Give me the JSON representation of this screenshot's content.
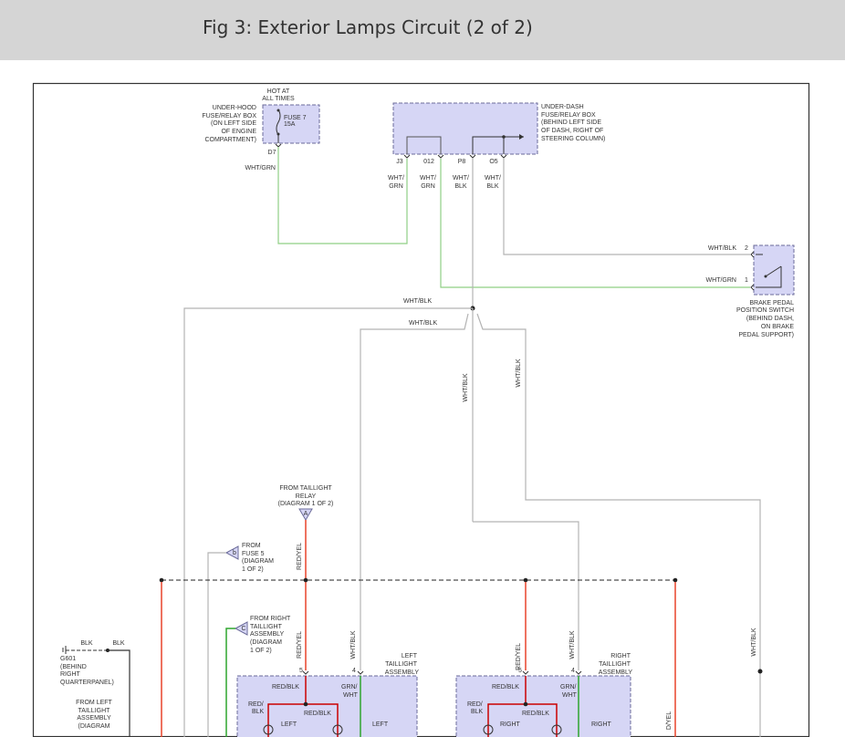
{
  "header": {
    "title": "Fig 3: Exterior Lamps Circuit (2 of 2)"
  },
  "colors": {
    "white_green_wire": "#8fcf85",
    "white_black_wire": "#b3b3b3",
    "red_wire": "#e8432a",
    "green_wire": "#2fa52f",
    "red_black_wire": "#cc0000",
    "component_fill": "#d6d6f5",
    "component_border": "#6b6b9a"
  },
  "labels": {
    "hot_at": "HOT AT",
    "all_times": "ALL TIMES",
    "underhood_1": "UNDER-HOOD",
    "underhood_2": "FUSE/RELAY BOX",
    "underhood_3": "(ON LEFT SIDE",
    "underhood_4": "OF ENGINE",
    "underhood_5": "COMPARTMENT)",
    "fuse7": "FUSE 7",
    "fuse7_amp": "15A",
    "pin_d7": "D7",
    "wire_d7": "WHT/GRN",
    "underdash_1": "UNDER-DASH",
    "underdash_2": "FUSE/RELAY BOX",
    "underdash_3": "(BEHIND LEFT SIDE",
    "underdash_4": "OF DASH, RIGHT OF",
    "underdash_5": "STEERING COLUMN)",
    "pin_j3": "J3",
    "pin_o12": "012",
    "pin_p8": "P8",
    "pin_o5": "O5",
    "wht": "WHT/",
    "grn": "GRN",
    "blk": "BLK",
    "bp_wire2": "WHT/BLK",
    "bp_pin2": "2",
    "bp_wire1": "WHT/GRN",
    "bp_pin1": "1",
    "bp_1": "BRAKE PEDAL",
    "bp_2": "POSITION SWITCH",
    "bp_3": "(BEHIND DASH,",
    "bp_4": "ON BRAKE",
    "bp_5": "PEDAL SUPPORT)",
    "wht_blk_top": "WHT/BLK",
    "wht_blk_mid": "WHT/BLK",
    "wht_blk_v1": "WHT/BLK",
    "wht_blk_v2": "WHT/BLK",
    "relay_1": "FROM TAILLIGHT",
    "relay_2": "RELAY",
    "relay_3": "(DIAGRAM 1 OF 2)",
    "conn_a": "A",
    "conn_b": "b",
    "conn_c": "C",
    "fuse5_1": "FROM",
    "fuse5_2": "FUSE 5",
    "fuse5_3": "(DIAGRAM",
    "fuse5_4": "1 OF 2)",
    "rt_1": "FROM RIGHT",
    "rt_2": "TAILLIGHT",
    "rt_3": "ASSEMBLY",
    "rt_4": "(DIAGRAM",
    "rt_5": "1 OF 2)",
    "red_yel_v1": "RED/YEL",
    "red_yel_v2": "RED/YEL",
    "red_yel_v3": "RED/YEL",
    "wht_blk_v3": "WHT/BLK",
    "wht_blk_v4": "WHT/BLK",
    "wht_blk_v5": "WHT/BLK",
    "dyel_partial": "D/YEL",
    "g601_blk1": "BLK",
    "g601_blk2": "BLK",
    "g601_1": "G601",
    "g601_2": "(BEHIND",
    "g601_3": "RIGHT",
    "g601_4": "QUARTERPANEL)",
    "lt_1": "LEFT",
    "lt_2": "TAILLIGHT",
    "lt_3": "ASSEMBLY",
    "rta_1": "RIGHT",
    "rta_2": "TAILLIGHT",
    "rta_3": "ASSEMBLY",
    "pin5_l": "5",
    "pin4_l": "4",
    "pin5_r": "5",
    "pin4_r": "4",
    "redblk_l1": "RED/BLK",
    "grn_l": "GRN/",
    "wht_l": "WHT",
    "red_l": "RED/",
    "blk_l": "BLK",
    "redblk_l2": "RED/BLK",
    "left_l1": "LEFT",
    "left_l2": "LEFT",
    "redblk_r1": "RED/BLK",
    "grn_r": "GRN/",
    "wht_r": "WHT",
    "red_r": "RED/",
    "blk_r": "BLK",
    "redblk_r2": "RED/BLK",
    "right_r1": "RIGHT",
    "right_r2": "RIGHT",
    "fl_1": "FROM LEFT",
    "fl_2": "TAILLIGHT",
    "fl_3": "ASSEMBLY",
    "fl_4": "(DIAGRAM"
  }
}
